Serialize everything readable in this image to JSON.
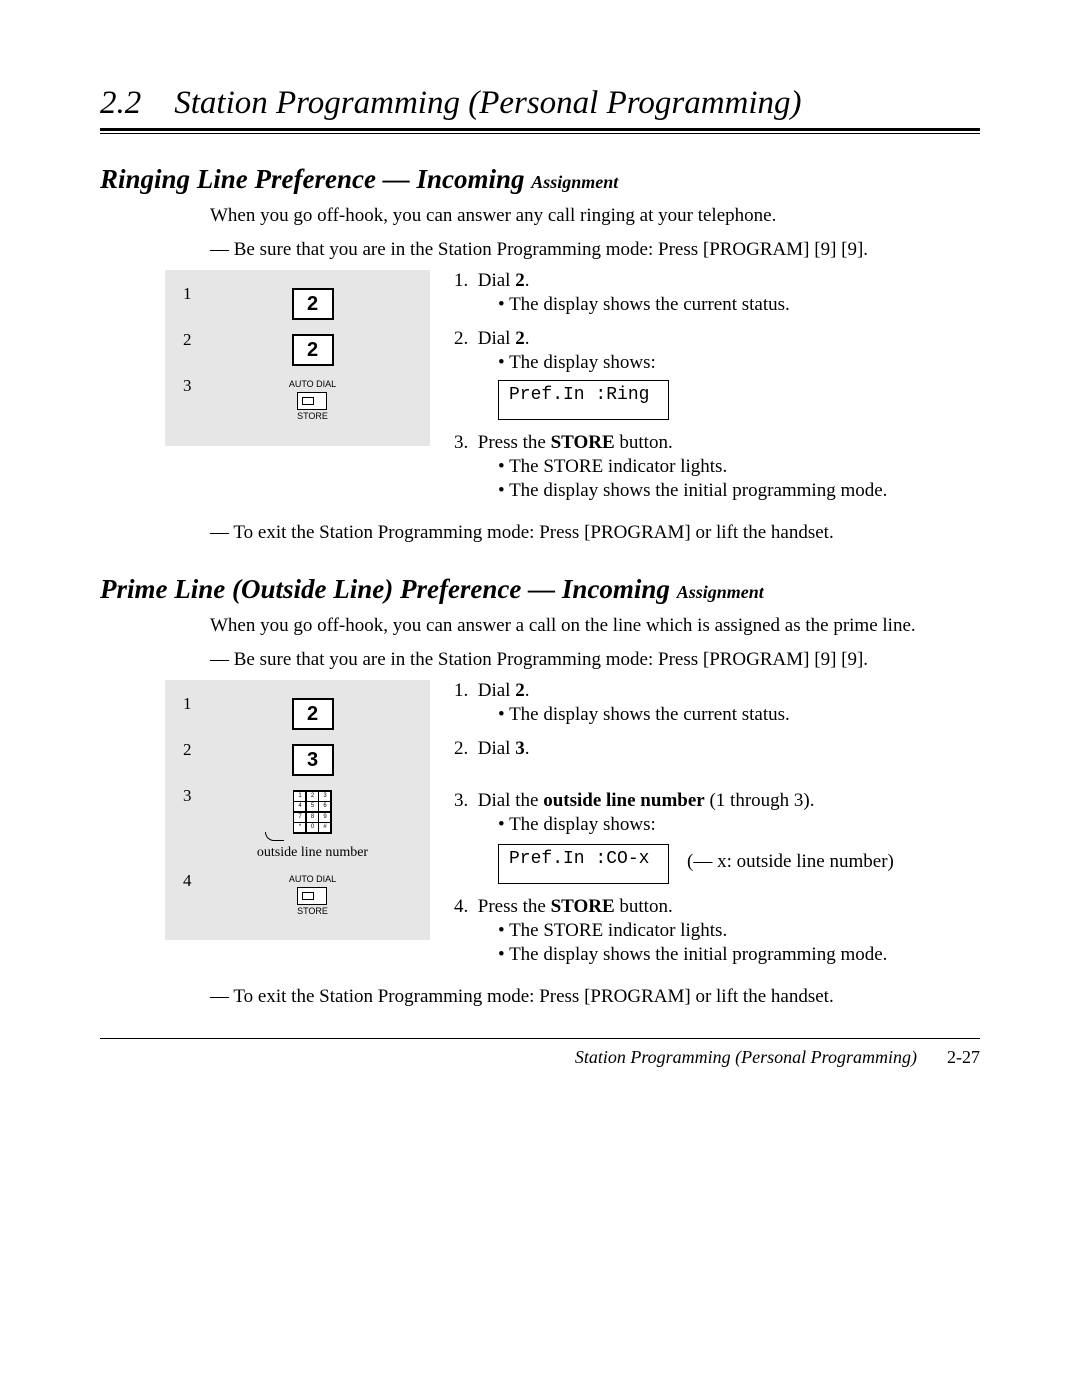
{
  "header": {
    "number": "2.2",
    "title": "Station Programming (Personal Programming)"
  },
  "sections": [
    {
      "title_main": "Ringing Line Preference — Incoming ",
      "title_sub": "Assignment",
      "intro": "When you go off-hook, you can answer any call ringing at your telephone.",
      "precond": "— Be sure that you are in the Station Programming mode: Press [PROGRAM] [9] [9].",
      "diagram": {
        "items": [
          {
            "num": "1",
            "type": "key",
            "label": "2"
          },
          {
            "num": "2",
            "type": "key",
            "label": "2"
          },
          {
            "num": "3",
            "type": "store",
            "top": "AUTO DIAL",
            "bottom": "STORE"
          }
        ]
      },
      "steps": [
        {
          "num": "1.",
          "text_before": "Dial ",
          "bold": "2",
          "text_after": ".",
          "bullets": [
            "The display shows the current status."
          ]
        },
        {
          "num": "2.",
          "text_before": "Dial ",
          "bold": "2",
          "text_after": ".",
          "bullets": [
            "The display shows:"
          ],
          "display": "Pref.In :Ring"
        },
        {
          "num": "3.",
          "text_before": "Press the ",
          "bold": "STORE",
          "text_after": " button.",
          "bullets": [
            "The STORE indicator lights.",
            "The display shows the initial programming mode."
          ]
        }
      ],
      "exit": "— To exit the Station Programming mode: Press [PROGRAM] or lift the handset."
    },
    {
      "title_main": "Prime Line (Outside Line) Preference — Incoming ",
      "title_sub": "Assignment",
      "intro": "When you go off-hook, you can answer a call on the line which is assigned as the prime line.",
      "precond": "— Be sure that you are in the Station Programming mode: Press [PROGRAM] [9] [9].",
      "diagram": {
        "items": [
          {
            "num": "1",
            "type": "key",
            "label": "2"
          },
          {
            "num": "2",
            "type": "key",
            "label": "3"
          },
          {
            "num": "3",
            "type": "keypad",
            "caption": "outside line number"
          },
          {
            "num": "4",
            "type": "store",
            "top": "AUTO DIAL",
            "bottom": "STORE"
          }
        ]
      },
      "steps": [
        {
          "num": "1.",
          "text_before": "Dial ",
          "bold": "2",
          "text_after": ".",
          "bullets": [
            "The display shows the current status."
          ]
        },
        {
          "num": "2.",
          "text_before": "Dial ",
          "bold": "3",
          "text_after": "."
        },
        {
          "num": "3.",
          "text_before": "Dial the ",
          "bold": "outside line number",
          "text_after": " (1 through 3).",
          "bullets": [
            "The display shows:"
          ],
          "display": "Pref.In :CO-x",
          "display_note": "(— x: outside line number)"
        },
        {
          "num": "4.",
          "text_before": "Press the ",
          "bold": "STORE",
          "text_after": " button.",
          "bullets": [
            "The STORE indicator lights.",
            "The display shows the initial programming mode."
          ]
        }
      ],
      "exit": "— To exit the Station Programming mode: Press [PROGRAM] or lift the handset."
    }
  ],
  "footer": {
    "title": "Station Programming (Personal Programming)",
    "page": "2-27"
  }
}
